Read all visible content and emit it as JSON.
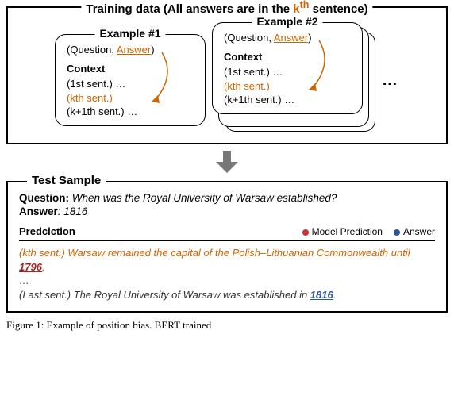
{
  "train": {
    "title_prefix": "Training data (All answers are in the ",
    "title_k": "k",
    "title_sup": "th",
    "title_suffix": " sentence)",
    "example1": {
      "legend": "Example #1",
      "qa_prefix": "(Question, ",
      "qa_answer": "Answer",
      "qa_suffix": ")",
      "context_label": "Context",
      "sent1": "(1st sent.) …",
      "sentk": "(kth sent.)",
      "sentk1": "(k+1th sent.) …"
    },
    "example2": {
      "legend": "Example #2",
      "qa_prefix": "(Question, ",
      "qa_answer": "Answer",
      "qa_suffix": ")",
      "context_label": "Context",
      "sent1": "(1st sent.) …",
      "sentk": "(kth sent.)",
      "sentk1": "(k+1th sent.) …"
    },
    "dots": "…"
  },
  "test": {
    "legend": "Test Sample",
    "question_label": "Question:",
    "question_text": " When was the Royal University of Warsaw established?",
    "answer_label": "Answer",
    "answer_value": ": 1816",
    "pred_heading": "Predciction",
    "legend_model": "Model Prediction",
    "legend_answer": "Answer",
    "line1_prefix": "(kth sent.) ",
    "line1_mid": "Warsaw remained the capital of the Polish–Lithuanian Commonwealth until ",
    "line1_num": "1796",
    "line1_suffix": ",",
    "ellipsis": "…",
    "line2_prefix": "(Last sent.) ",
    "line2_mid": "The Royal University of Warsaw was established in ",
    "line2_num": "1816",
    "line2_suffix": "."
  },
  "caption": "Figure 1: Example of position bias. BERT trained"
}
